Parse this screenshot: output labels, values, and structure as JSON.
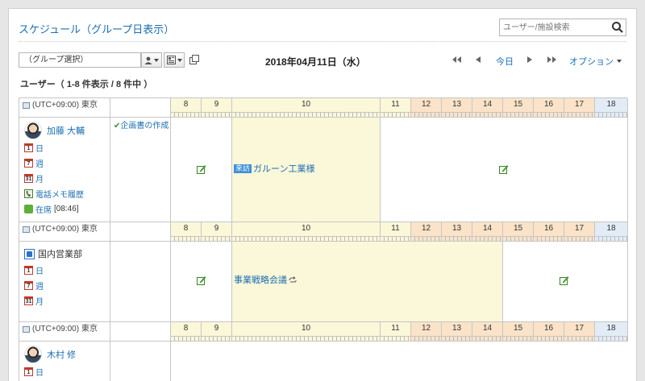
{
  "header": {
    "title": "スケジュール（グループ日表示）",
    "search_placeholder": "ユーザー/施設検索"
  },
  "toolbar": {
    "group_select": "（グループ選択）",
    "date": "2018年04月11日（水）",
    "today": "今日",
    "options": "オプション"
  },
  "count_label": "ユーザー（ 1-8 件表示 / 8 件中 ）",
  "timezone": "(UTC+09:00) 東京",
  "hours": [
    "8",
    "9",
    "10",
    "11",
    "12",
    "13",
    "14",
    "15",
    "16",
    "17",
    "18"
  ],
  "colors": {
    "accent": "#1b6fb3",
    "event_bg": "#fbf7d9",
    "header_bg": "#fbf7d9",
    "after_hours": "#fae3c8",
    "late": "#e2ecf7"
  },
  "rows": [
    {
      "name": "加藤 大輔",
      "links": [
        "日",
        "週",
        "月",
        "電話メモ履歴",
        "在席"
      ],
      "status_time": "[08:46]",
      "todo": "企画書の作成",
      "event_tag": "来訪",
      "event_title": "ガルーン工業様"
    },
    {
      "name": "国内営業部",
      "links": [
        "日",
        "週",
        "月"
      ],
      "event_title": "事業戦略会議"
    },
    {
      "name": "木村 修",
      "links": [
        "日"
      ]
    }
  ]
}
